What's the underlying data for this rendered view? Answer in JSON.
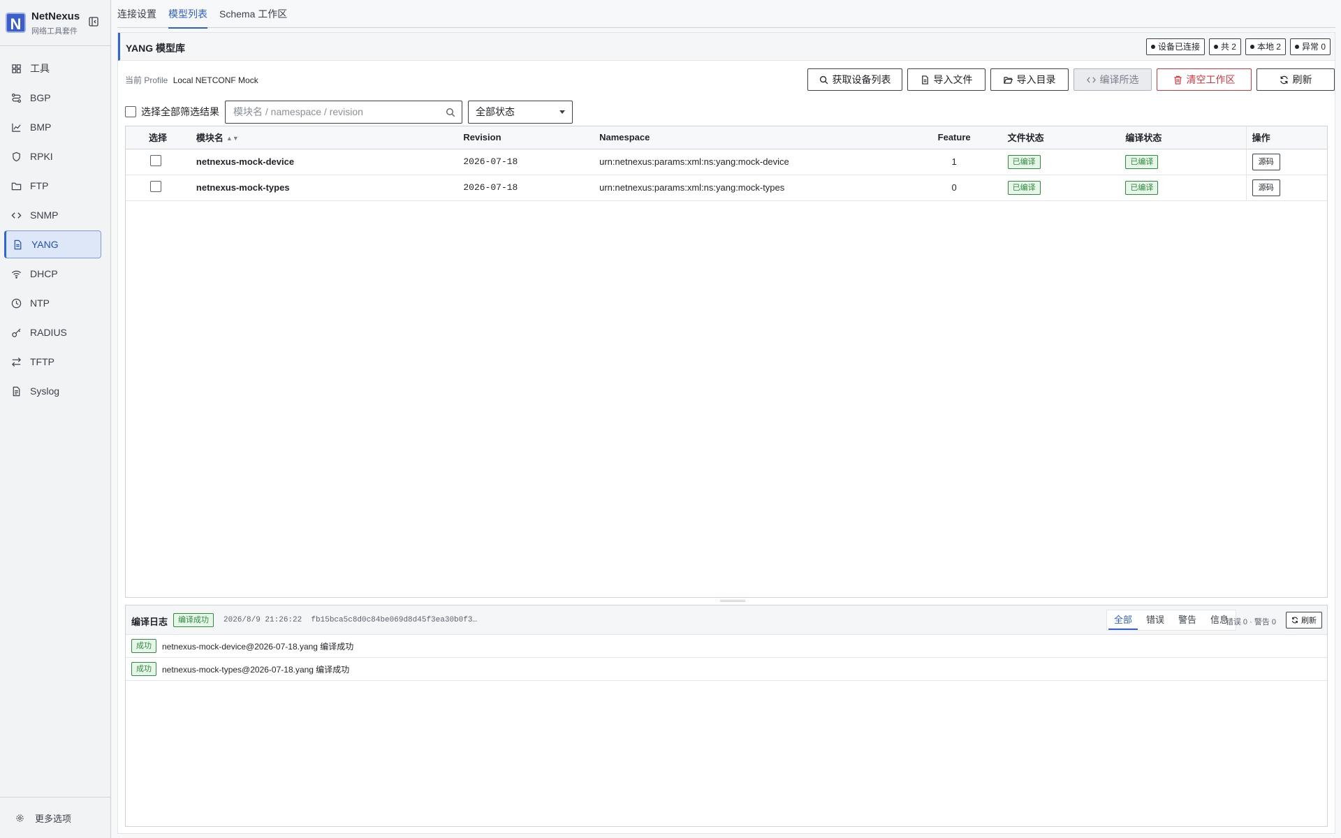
{
  "app": {
    "name": "NetNexus",
    "subtitle": "网络工具套件"
  },
  "sidebar": {
    "items": [
      {
        "label": "工具",
        "icon": "grid-icon"
      },
      {
        "label": "BGP",
        "icon": "route-icon"
      },
      {
        "label": "BMP",
        "icon": "chart-icon"
      },
      {
        "label": "RPKI",
        "icon": "shield-icon"
      },
      {
        "label": "FTP",
        "icon": "folder-icon"
      },
      {
        "label": "SNMP",
        "icon": "code-icon"
      },
      {
        "label": "YANG",
        "icon": "file-icon",
        "active": true
      },
      {
        "label": "DHCP",
        "icon": "wifi-icon"
      },
      {
        "label": "NTP",
        "icon": "clock-icon"
      },
      {
        "label": "RADIUS",
        "icon": "key-icon"
      },
      {
        "label": "TFTP",
        "icon": "transfer-icon"
      },
      {
        "label": "Syslog",
        "icon": "doc-icon"
      }
    ],
    "more_label": "更多选项"
  },
  "tabs": [
    "连接设置",
    "模型列表",
    "Schema 工作区"
  ],
  "active_tab": 1,
  "panel": {
    "title": "YANG 模型库",
    "stats": [
      "设备已连接",
      "共 2",
      "本地 2",
      "异常 0"
    ],
    "profile_label": "当前 Profile",
    "profile_value": "Local NETCONF Mock",
    "buttons": {
      "fetch": "获取设备列表",
      "import_file": "导入文件",
      "import_dir": "导入目录",
      "compile": "编译所选",
      "clear": "清空工作区",
      "refresh": "刷新"
    },
    "select_all_label": "选择全部筛选结果",
    "search_placeholder": "模块名 / namespace / revision",
    "status_filter": "全部状态"
  },
  "table": {
    "headers": {
      "select": "选择",
      "name": "模块名",
      "revision": "Revision",
      "namespace": "Namespace",
      "feature": "Feature",
      "file_status": "文件状态",
      "compile_status": "编译状态",
      "actions": "操作"
    },
    "rows": [
      {
        "name": "netnexus-mock-device",
        "revision": "2026-07-18",
        "namespace": "urn:netnexus:params:xml:ns:yang:mock-device",
        "feature": "1",
        "file_status": "已编译",
        "compile_status": "已编译",
        "action": "源码"
      },
      {
        "name": "netnexus-mock-types",
        "revision": "2026-07-18",
        "namespace": "urn:netnexus:params:xml:ns:yang:mock-types",
        "feature": "0",
        "file_status": "已编译",
        "compile_status": "已编译",
        "action": "源码"
      }
    ]
  },
  "log": {
    "title": "编译日志",
    "status": "编译成功",
    "timestamp": "2026/8/9 21:26:22",
    "hash": "fb15bca5c8d0c84be069d8d45f3ea30b0f3…",
    "tabs": [
      "全部",
      "错误",
      "警告",
      "信息"
    ],
    "count_text": "错误 0 · 警告 0",
    "refresh": "刷新",
    "entries": [
      {
        "badge": "成功",
        "text": "netnexus-mock-device@2026-07-18.yang 编译成功"
      },
      {
        "badge": "成功",
        "text": "netnexus-mock-types@2026-07-18.yang 编译成功"
      }
    ]
  },
  "colors": {
    "accent": "#3366cc",
    "success": "#2e8a3e",
    "danger": "#d4343c"
  }
}
